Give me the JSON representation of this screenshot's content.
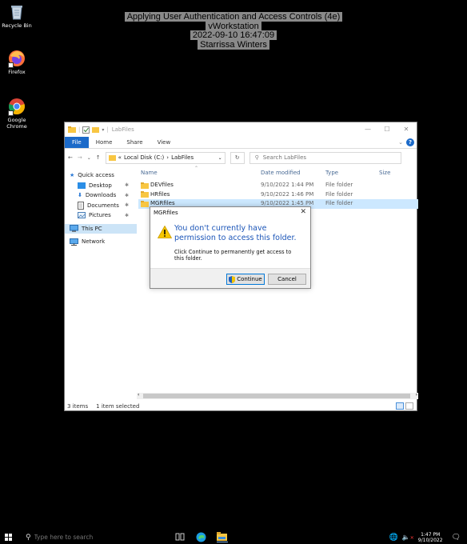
{
  "watermark": {
    "line1": "Applying User Authentication and Access Controls (4e)",
    "line2": "vWorkstation",
    "line3": "2022-09-10 16:47:09",
    "line4": "Starrissa Winters"
  },
  "desktop": {
    "icons": [
      {
        "label": "Recycle Bin",
        "icon": "recycle-bin-icon"
      },
      {
        "label": "Firefox",
        "icon": "firefox-icon"
      },
      {
        "label": "Google Chrome",
        "icon": "chrome-icon"
      }
    ]
  },
  "explorer": {
    "title": "LabFiles",
    "tabs": [
      "File",
      "Home",
      "Share",
      "View"
    ],
    "breadcrumb": {
      "prefix": "«",
      "drive": "Local Disk (C:)",
      "sep": "›",
      "folder": "LabFiles"
    },
    "search_placeholder": "Search LabFiles",
    "nav": [
      {
        "label": "Quick access",
        "pinned": false
      },
      {
        "label": "Desktop",
        "pinned": true
      },
      {
        "label": "Downloads",
        "pinned": true
      },
      {
        "label": "Documents",
        "pinned": true
      },
      {
        "label": "Pictures",
        "pinned": true
      },
      {
        "label": "This PC",
        "pinned": false
      },
      {
        "label": "Network",
        "pinned": false
      }
    ],
    "columns": {
      "name": "Name",
      "date": "Date modified",
      "type": "Type",
      "size": "Size"
    },
    "files": [
      {
        "name": "DEVfiles",
        "date": "9/10/2022 1:44 PM",
        "type": "File folder"
      },
      {
        "name": "HRfiles",
        "date": "9/10/2022 1:46 PM",
        "type": "File folder"
      },
      {
        "name": "MGRfiles",
        "date": "9/10/2022 1:45 PM",
        "type": "File folder"
      }
    ],
    "status": {
      "count": "3 items",
      "selected": "1 item selected"
    }
  },
  "dialog": {
    "title": "MGRfiles",
    "message": "You don't currently have permission to access this folder.",
    "detail": "Click Continue to permanently get access to this folder.",
    "continue_label": "Continue",
    "cancel_label": "Cancel"
  },
  "taskbar": {
    "search_placeholder": "Type here to search",
    "time": "1:47 PM",
    "date": "9/10/2022"
  },
  "colors": {
    "accent": "#1b6ac9",
    "folder": "#f8c642",
    "selection": "#cce8ff",
    "dialog_heading": "#1b55b8"
  }
}
